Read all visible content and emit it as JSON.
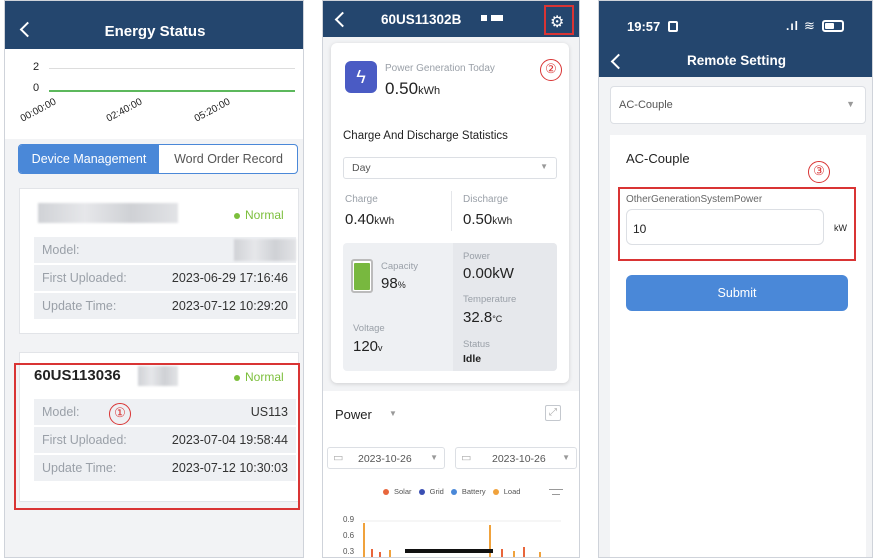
{
  "p1": {
    "title": "Energy Status",
    "chart": {
      "y_ticks": [
        "2",
        "0"
      ],
      "x_ticks": [
        "00:00:00",
        "02:40:00",
        "05:20:00"
      ]
    },
    "tabs": [
      "Device Management",
      "Word Order Record"
    ],
    "device1": {
      "status": "Normal",
      "model_label": "Model:",
      "uploaded_label": "First Uploaded:",
      "uploaded": "2023-06-29 17:16:46",
      "update_label": "Update Time:",
      "update": "2023-07-12 10:29:20"
    },
    "device2": {
      "name": "60US113036",
      "status": "Normal",
      "model_label": "Model:",
      "model": "US113",
      "uploaded_label": "First Uploaded:",
      "uploaded": "2023-07-04 19:58:44",
      "update_label": "Update Time:",
      "update": "2023-07-12 10:30:03"
    },
    "marker": "①",
    "colors": {
      "header": "#24466e",
      "accent": "#4a88d8",
      "normal": "#7cbf3c",
      "annotation": "#d93434"
    }
  },
  "p2": {
    "title": "60US11302B",
    "marker": "②",
    "gen_label": "Power Generation Today",
    "gen_value": "0.50",
    "gen_unit": "kWh",
    "stats_title": "Charge And Discharge Statistics",
    "period": "Day",
    "charge_label": "Charge",
    "charge_value": "0.40",
    "charge_unit": "kWh",
    "discharge_label": "Discharge",
    "discharge_value": "0.50",
    "discharge_unit": "kWh",
    "capacity_label": "Capacity",
    "capacity_value": "98",
    "capacity_unit": "%",
    "capacity_level": 0.98,
    "power_label": "Power",
    "power_value": "0.00kW",
    "temp_label": "Temperature",
    "temp_value": "32.8",
    "temp_unit": "°C",
    "voltage_label": "Voltage",
    "voltage_value": "120",
    "voltage_unit": "v",
    "status_label": "Status",
    "status_value": "Idle",
    "power_section": "Power",
    "date1": "2023-10-26",
    "date2": "2023-10-26",
    "legend": [
      "Solar",
      "Grid",
      "Battery",
      "Load"
    ],
    "legend_colors": [
      "#e8663c",
      "#3a4fb3",
      "#4a88d8",
      "#f0a23c"
    ],
    "y_ticks": [
      "0.9",
      "0.6",
      "0.3"
    ]
  },
  "p3": {
    "time": "19:57",
    "title": "Remote Setting",
    "select_value": "AC-Couple",
    "section_label": "AC-Couple",
    "marker": "③",
    "field_label": "OtherGenerationSystemPower",
    "field_value": "10",
    "field_unit": "kW",
    "submit": "Submit"
  }
}
